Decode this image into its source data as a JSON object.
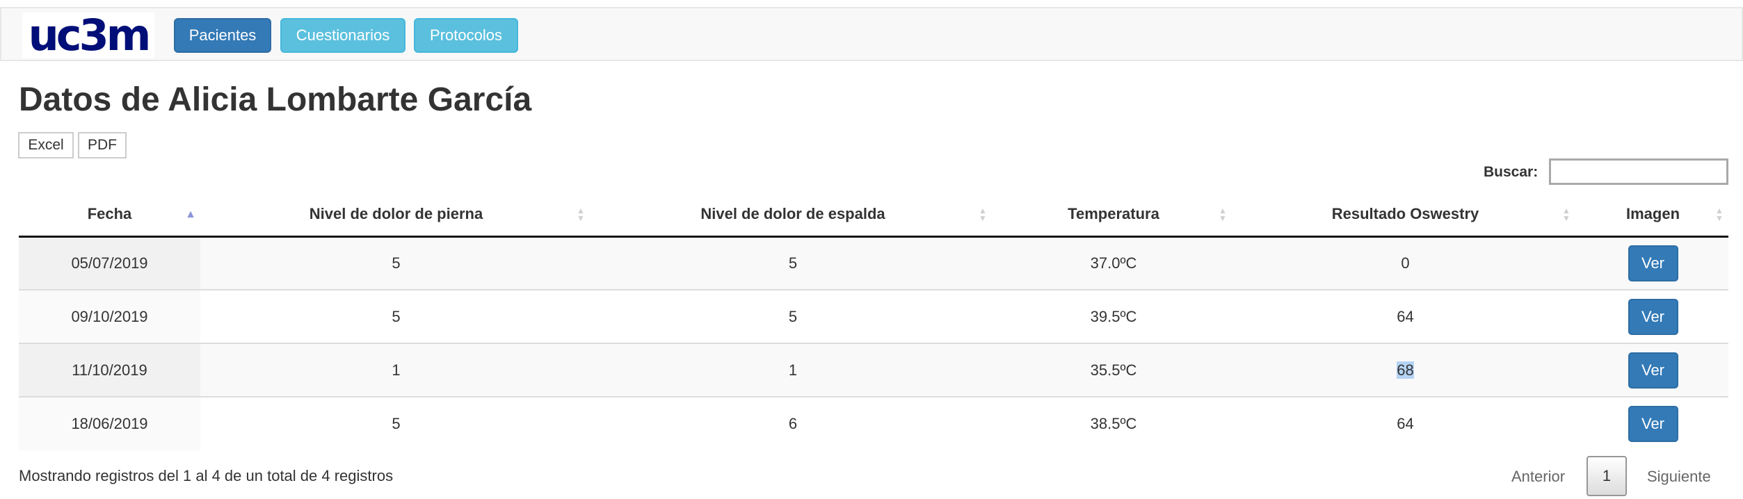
{
  "nav": {
    "logo_text": "uc3m",
    "buttons": [
      "Pacientes",
      "Cuestionarios",
      "Protocolos"
    ]
  },
  "page": {
    "title": "Datos de Alicia Lombarte García",
    "export": [
      "Excel",
      "PDF"
    ]
  },
  "search": {
    "label": "Buscar:",
    "value": ""
  },
  "table": {
    "columns": [
      "Fecha",
      "Nivel de dolor de pierna",
      "Nivel de dolor de espalda",
      "Temperatura",
      "Resultado Oswestry",
      "Imagen"
    ],
    "sort_icons": {
      "active": "sort-asc-icon",
      "inactive": "sort-both-icon"
    },
    "rows": [
      [
        "05/07/2019",
        "5",
        "5",
        "37.0ºC",
        "0",
        "Ver"
      ],
      [
        "09/10/2019",
        "5",
        "5",
        "39.5ºC",
        "64",
        "Ver"
      ],
      [
        "11/10/2019",
        "1",
        "1",
        "35.5ºC",
        "68",
        "Ver"
      ],
      [
        "18/06/2019",
        "5",
        "6",
        "38.5ºC",
        "64",
        "Ver"
      ]
    ],
    "highlighted_cell": {
      "row": 2,
      "col": 4
    }
  },
  "footer": {
    "info": "Mostrando registros del 1 al 4 de un total de 4 registros",
    "pagination": {
      "prev": "Anterior",
      "current": "1",
      "next": "Siguiente"
    }
  },
  "colors": {
    "primary": "#337ab7",
    "info": "#5bc0de",
    "logo": "#000e78",
    "selection": "#b4d3f5"
  }
}
